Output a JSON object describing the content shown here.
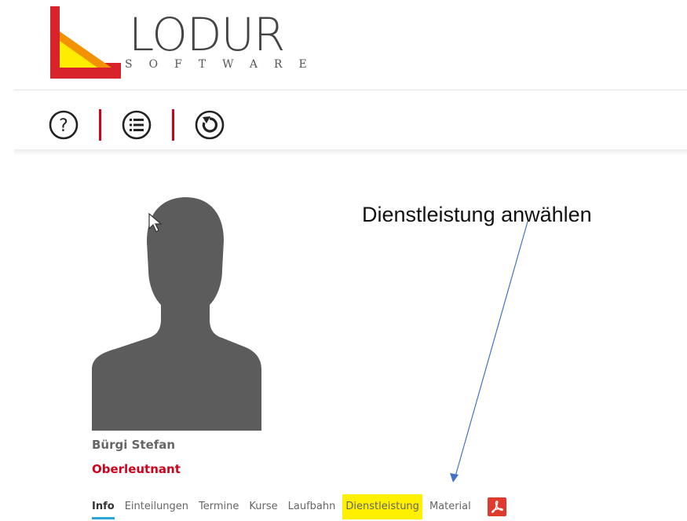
{
  "brand": {
    "name": "LODUR",
    "subtitle": "SOFTWARE",
    "colors": {
      "red": "#d9232b",
      "orange": "#f39200",
      "yellow": "#ffed00",
      "gray": "#444444"
    }
  },
  "toolbar": {
    "items": [
      {
        "icon": "help-icon"
      },
      {
        "icon": "list-icon"
      },
      {
        "icon": "refresh-icon"
      }
    ],
    "separator_color": "#d0021b"
  },
  "annotation": {
    "text": "Dienstleistung anwählen",
    "arrow_color": "#4472c4"
  },
  "profile": {
    "name": "Bürgi Stefan",
    "rank": "Oberleutnant",
    "rank_color": "#d0021b"
  },
  "tabs": [
    {
      "label": "Info",
      "active": true
    },
    {
      "label": "Einteilungen"
    },
    {
      "label": "Termine"
    },
    {
      "label": "Kurse"
    },
    {
      "label": "Laufbahn"
    },
    {
      "label": "Dienstleistung",
      "highlighted": true
    },
    {
      "label": "Material"
    }
  ],
  "pdf_button": {
    "icon": "pdf-icon"
  },
  "accent_tab_underline": "#2aa7d6",
  "highlight_color": "#fff000"
}
